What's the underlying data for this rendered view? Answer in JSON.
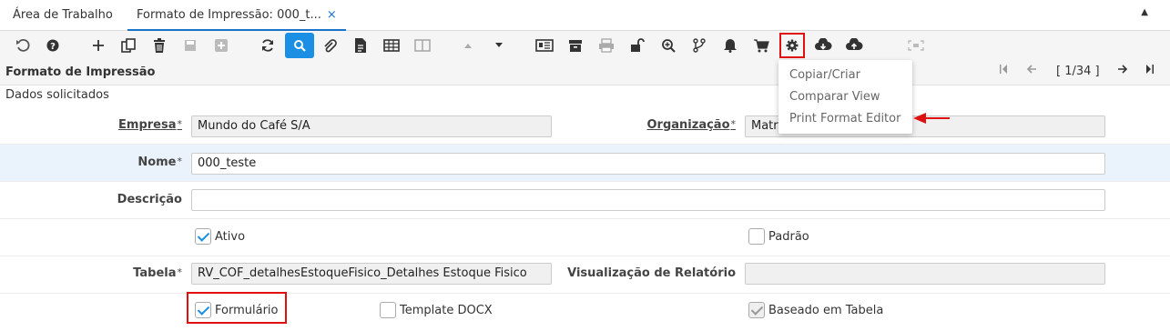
{
  "tabs": [
    {
      "label": "Área de Trabalho"
    },
    {
      "label": "Formato de Impressão: 000_t...",
      "close": "×"
    }
  ],
  "collapse_icon": "▲",
  "toolbar": {
    "icons": [
      "undo-icon",
      "help-icon",
      "new-icon",
      "copy-icon",
      "delete-icon",
      "save-icon",
      "save-new-icon",
      "refresh-icon",
      "search-icon",
      "attachment-icon",
      "report-icon",
      "grid-icon",
      "toggle-view-icon",
      "previous-parent-icon",
      "next-detail-icon",
      "archive-report-icon",
      "archive-icon",
      "print-icon",
      "lock-icon",
      "zoom-icon",
      "workflow-icon",
      "notification-icon",
      "cart-icon",
      "settings-icon",
      "download-icon",
      "upload-icon",
      "customize-icon"
    ]
  },
  "header": {
    "title": "Formato de Impressão",
    "record_counter": "[ 1/34 ]"
  },
  "section_label": "Dados solicitados",
  "fields": {
    "empresa_label": "Empresa",
    "empresa_value": "Mundo do Café S/A",
    "organizacao_label": "Organização",
    "organizacao_value": "Matr",
    "nome_label": "Nome",
    "nome_value": "000_teste",
    "descricao_label": "Descrição",
    "descricao_value": "",
    "ativo_label": "Ativo",
    "padrao_label": "Padrão",
    "tabela_label": "Tabela",
    "tabela_value": "RV_COF_detalhesEstoqueFisico_Detalhes Estoque Fisico",
    "visualizacao_label": "Visualização de Relatório",
    "visualizacao_value": "",
    "formulario_label": "Formulário",
    "template_docx_label": "Template DOCX",
    "baseado_tabela_label": "Baseado em Tabela",
    "required_mark": "*"
  },
  "dropdown": {
    "items": [
      "Copiar/Criar",
      "Comparar View",
      "Print Format Editor"
    ]
  },
  "colors": {
    "accent": "#1a8fe3",
    "highlight_box": "#e01010",
    "row_highlight": "#eaf3fc"
  }
}
